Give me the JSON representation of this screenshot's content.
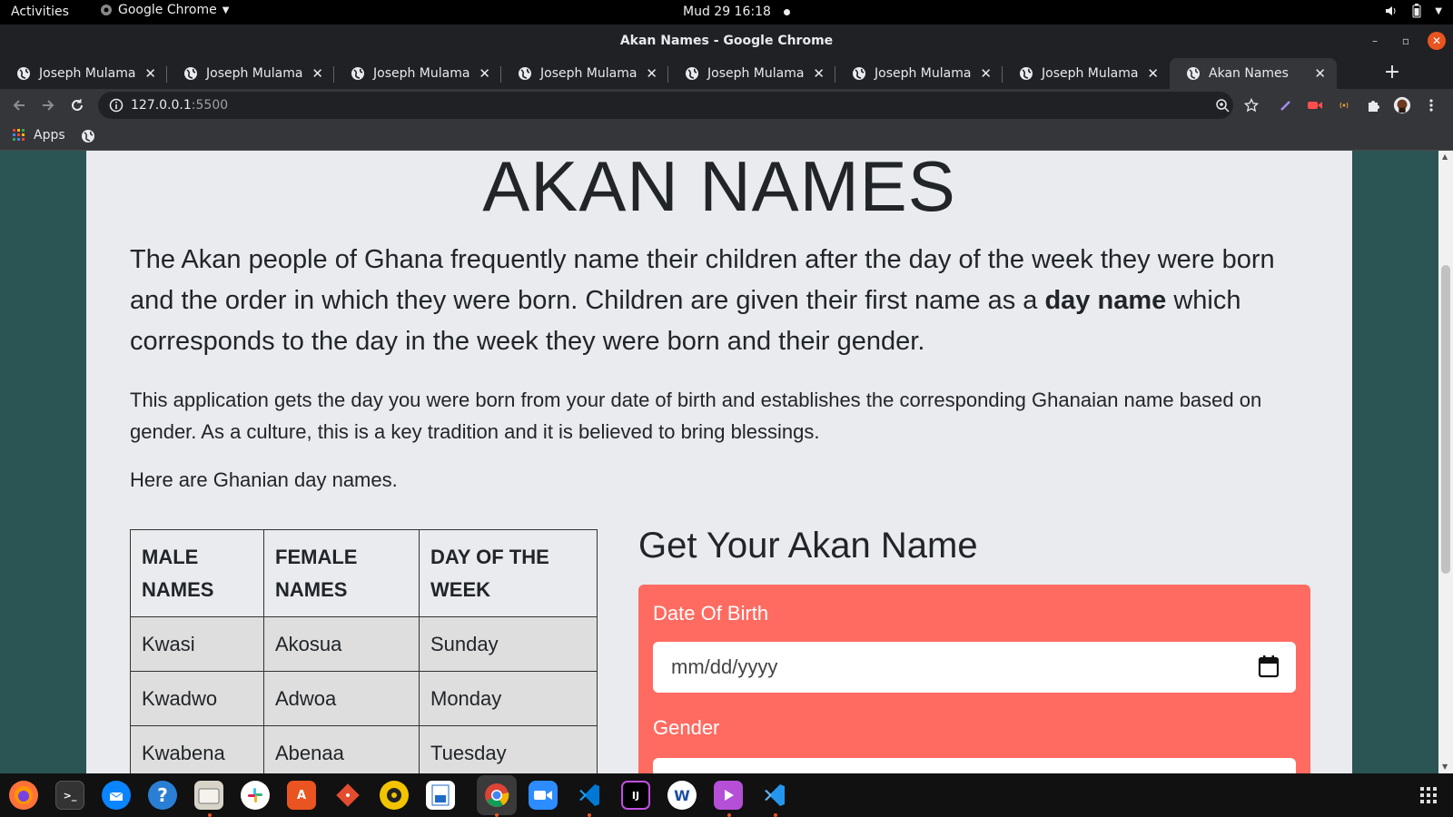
{
  "system": {
    "activities": "Activities",
    "app_menu": "Google Chrome",
    "clock": "Mud 29  16:18"
  },
  "window": {
    "title": "Akan Names - Google Chrome"
  },
  "tabs": [
    {
      "label": "Joseph Mulama"
    },
    {
      "label": "Joseph Mulama"
    },
    {
      "label": "Joseph Mulama"
    },
    {
      "label": "Joseph Mulama"
    },
    {
      "label": "Joseph Mulama"
    },
    {
      "label": "Joseph Mulama"
    },
    {
      "label": "Joseph Mulama"
    },
    {
      "label": "Akan Names",
      "active": true
    }
  ],
  "address": {
    "host": "127.0.0.1",
    "port": ":5500"
  },
  "bookmarks": {
    "apps_label": "Apps"
  },
  "page": {
    "heading": "AKAN NAMES",
    "lead_part1": "The Akan people of Ghana frequently name their children after the day of the week they were born and the order in which they were born. Children are given their first name as a ",
    "lead_bold": "day name",
    "lead_part2": " which corresponds to the day in the week they were born and their gender.",
    "paragraph2": "This application gets the day you were born from your date of birth and establishes the corresponding Ghanaian name based on gender. As a culture, this is a key tradition and it is believed to bring blessings.",
    "paragraph3": "Here are Ghanian day names.",
    "table": {
      "headers": [
        "MALE NAMES",
        "FEMALE NAMES",
        "DAY OF THE WEEK"
      ],
      "rows": [
        [
          "Kwasi",
          "Akosua",
          "Sunday"
        ],
        [
          "Kwadwo",
          "Adwoa",
          "Monday"
        ],
        [
          "Kwabena",
          "Abenaa",
          "Tuesday"
        ]
      ]
    },
    "form": {
      "title": "Get Your Akan Name",
      "dob_label": "Date Of Birth",
      "dob_placeholder": "mm/dd/yyyy",
      "gender_label": "Gender"
    }
  },
  "colors": {
    "page_background": "#2b5454",
    "content_background": "#e9ebee",
    "form_background": "#ff6b61",
    "chrome_dark": "#202124",
    "chrome_toolbar": "#35363a"
  },
  "icons": {
    "tab_favicon": "globe-icon",
    "dock": [
      "firefox-icon",
      "terminal-icon",
      "thunderbird-icon",
      "help-icon",
      "files-icon",
      "slack-icon",
      "software-center-icon",
      "git-icon",
      "rhythmbox-icon",
      "libreoffice-writer-icon",
      "chrome-icon",
      "zoom-icon",
      "vscode-icon",
      "intellij-icon",
      "app-icon",
      "media-player-icon",
      "vscode-insiders-icon"
    ]
  }
}
